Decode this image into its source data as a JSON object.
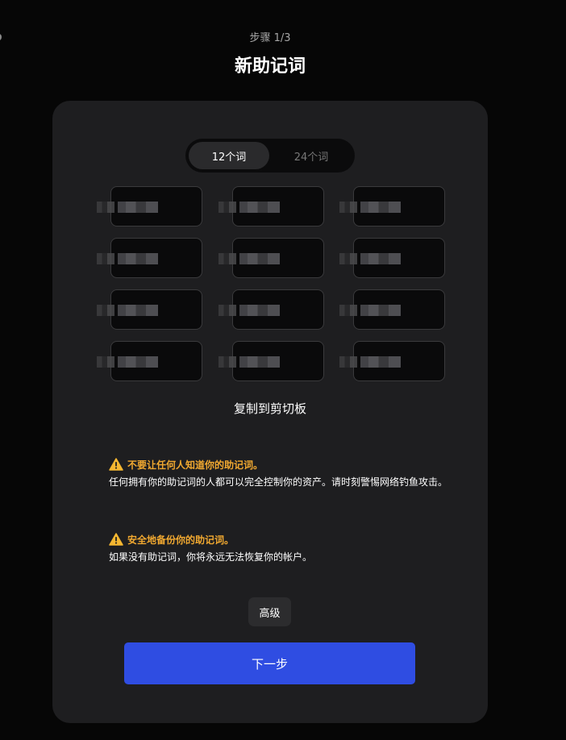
{
  "header": {
    "step": "步骤 1/3",
    "title": "新助记词"
  },
  "word_count_toggle": {
    "options": [
      "12个词",
      "24个词"
    ],
    "selected": "12个词"
  },
  "mnemonic": {
    "word_count": 12,
    "words_obscured": true
  },
  "copy_label": "复制到剪切板",
  "warnings": [
    {
      "icon": "warning-icon",
      "title": "不要让任何人知道你的助记词。",
      "body": "任何拥有你的助记词的人都可以完全控制你的资产。请时刻警惕网络钓鱼攻击。"
    },
    {
      "icon": "warning-icon",
      "title": "安全地备份你的助记词。",
      "body": "如果没有助记词，你将永远无法恢复你的帐户。"
    }
  ],
  "advanced_label": "高级",
  "next_label": "下一步",
  "colors": {
    "background": "#060606",
    "card": "#1e1e20",
    "warning": "#f0a830",
    "primary": "#2f4de2"
  }
}
